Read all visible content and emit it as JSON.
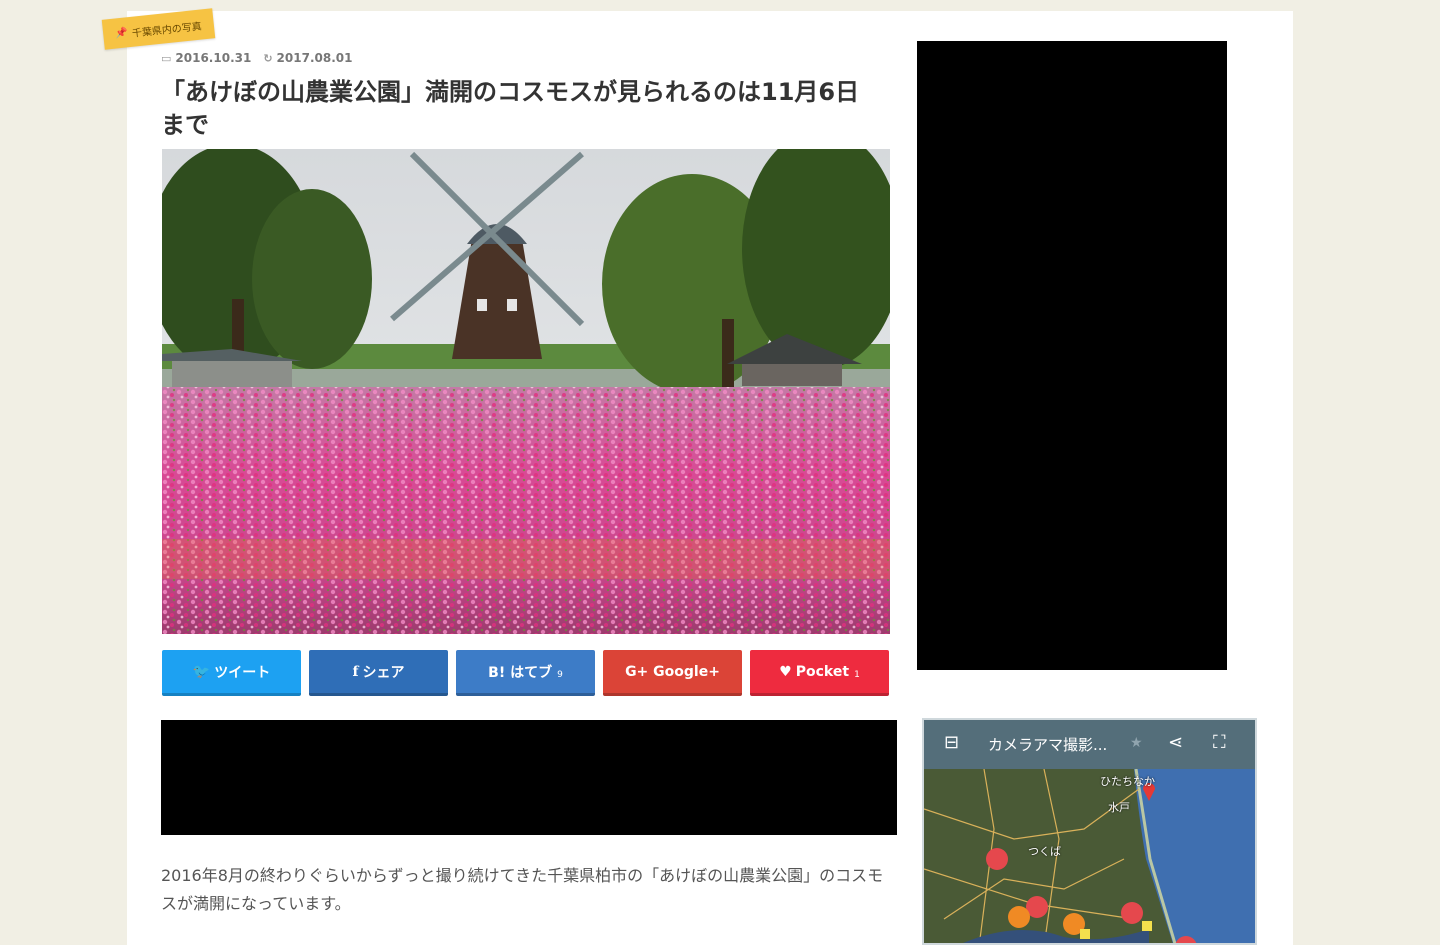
{
  "category_tag": {
    "label": "千葉県内の写真",
    "icon": "pin-icon"
  },
  "meta": {
    "published": "2016.10.31",
    "published_icon": "calendar-icon",
    "updated": "2017.08.01",
    "updated_icon": "refresh-icon"
  },
  "article": {
    "title": "「あけぼの山農業公園」満開のコスモスが見られるのは11月6日まで",
    "hero_image": "windmill-cosmos-field-photo",
    "intro": "2016年8月の終わりぐらいからずっと撮り続けてきた千葉県柏市の「あけぼの山農業公園」のコスモスが満開になっています。"
  },
  "share": {
    "twitter": {
      "label": "ツイート",
      "icon": "twitter-icon",
      "color": "#1da1f2"
    },
    "facebook": {
      "label": "シェア",
      "icon": "facebook-icon",
      "color": "#2f6eb7"
    },
    "hatena": {
      "label": "B! はてブ",
      "count": "9",
      "color": "#3d7cc7"
    },
    "google": {
      "label": "G+ Google+",
      "color": "#db4437"
    },
    "pocket": {
      "label": "Pocket",
      "count": "1",
      "icon": "pocket-icon",
      "color": "#ee2b3f"
    }
  },
  "map_widget": {
    "title": "カメラアマ撮影...",
    "labels": [
      "ひたちなか",
      "水戸",
      "つくば"
    ],
    "icons": [
      "sidebar-toggle-icon",
      "star-icon",
      "share-icon",
      "fullscreen-icon"
    ]
  }
}
